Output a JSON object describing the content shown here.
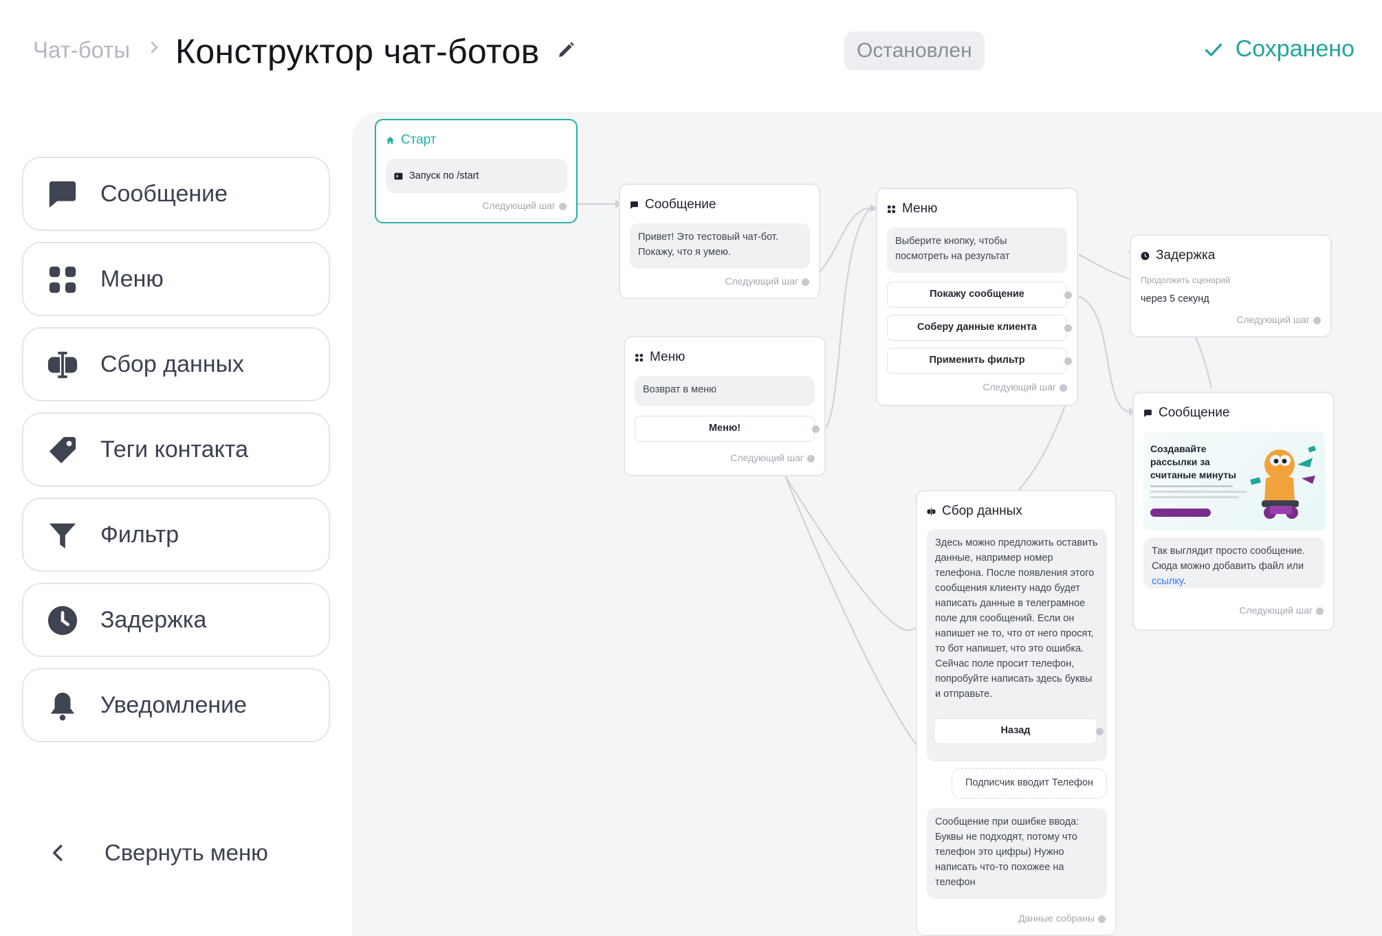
{
  "header": {
    "breadcrumb_parent": "Чат-боты",
    "title": "Конструктор чат-ботов",
    "status": "Остановлен",
    "saved": "Сохранено"
  },
  "colors": {
    "accent": "#1fa69a",
    "sidebar_icon": "#3f4452",
    "link": "#2f7cf6"
  },
  "sidebar": {
    "items": [
      {
        "label": "Сообщение",
        "icon": "message-icon"
      },
      {
        "label": "Меню",
        "icon": "menu-grid-icon"
      },
      {
        "label": "Сбор данных",
        "icon": "input-cursor-icon"
      },
      {
        "label": "Теги контакта",
        "icon": "tag-icon"
      },
      {
        "label": "Фильтр",
        "icon": "filter-icon"
      },
      {
        "label": "Задержка",
        "icon": "clock-icon"
      },
      {
        "label": "Уведомление",
        "icon": "bell-icon"
      }
    ],
    "collapse_label": "Свернуть меню"
  },
  "nodes": {
    "start": {
      "title": "Старт",
      "trigger": "Запуск по /start",
      "next": "Следующий шаг"
    },
    "message1": {
      "title": "Сообщение",
      "text": "Привет! Это тестовый чат-бот. Покажу, что я умею.",
      "next": "Следующий шаг"
    },
    "menu_main": {
      "title": "Меню",
      "text": "Выберите кнопку, чтобы посмотреть на результат",
      "buttons": [
        "Покажу сообщение",
        "Соберу данные клиента",
        "Применить фильтр"
      ],
      "next": "Следующий шаг"
    },
    "delay": {
      "title": "Задержка",
      "caption": "Продолжить сценарий",
      "value": "через 5 секунд",
      "next": "Следующий шаг"
    },
    "menu_back": {
      "title": "Меню",
      "text": "Возврат в меню",
      "button": "Меню!",
      "next": "Следующий шаг"
    },
    "message2": {
      "title": "Сообщение",
      "promo_title": "Создавайте рассылки за считаные минуты",
      "text": "Так выглядит просто сообщение. Сюда можно добавить файл или ",
      "link": "ссылку",
      "text_end": ".",
      "next": "Следующий шаг"
    },
    "collect": {
      "title": "Сбор данных",
      "text": "Здесь можно предложить оставить данные, например номер телефона. После появления этого сообщения клиенту надо будет написать данные в телеграмное поле для сообщений. Если он напишет не то, что от него просят, то бот напишет, что это ошибка. Сейчас поле просит телефон, попробуйте написать здесь буквы и отправьте.",
      "button": "Назад",
      "input_label": "Подписчик вводит Телефон",
      "error_text": "Сообщение при ошибке ввода: Буквы не подходят, потому что телефон это цифры) Нужно написать что-то похожее на телефон",
      "done": "Данные собраны"
    }
  }
}
